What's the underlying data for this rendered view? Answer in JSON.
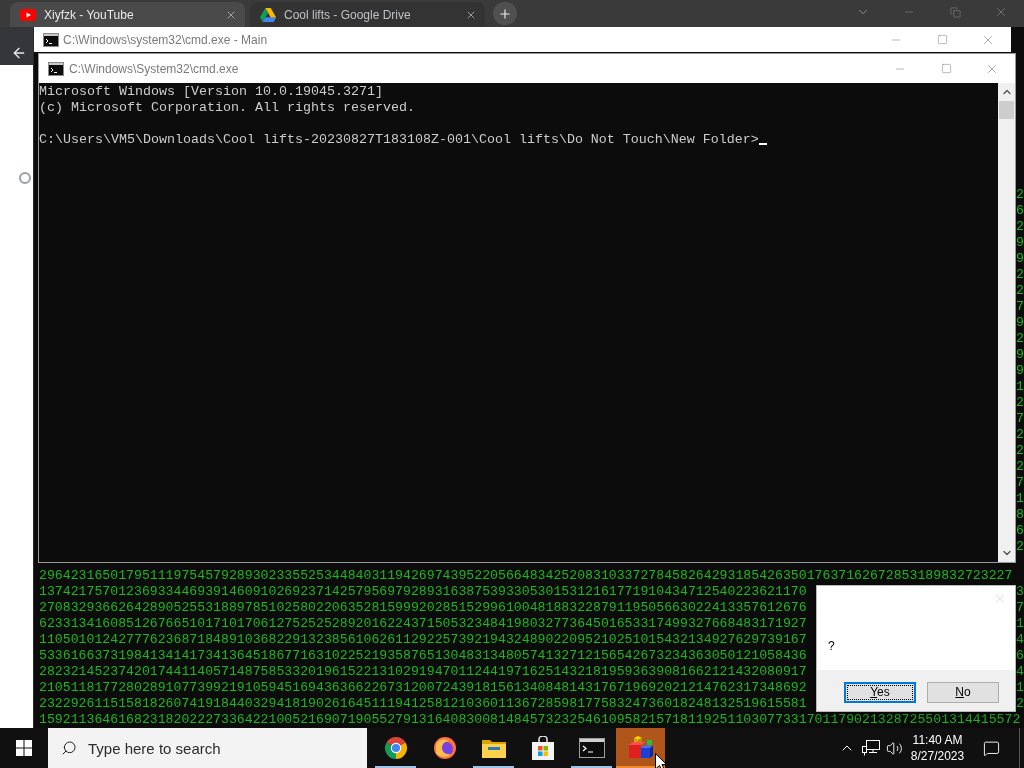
{
  "browser": {
    "tabs": [
      {
        "title": "Xiyfzk - YouTube",
        "kind": "video",
        "selected": true
      },
      {
        "title": "Cool lifts - Google Drive",
        "kind": "drive",
        "selected": false
      }
    ]
  },
  "main_console": {
    "title": "C:\\Windows\\system32\\cmd.exe - Main",
    "edge_column": "26299227929912722271862",
    "rows": [
      {
        "text": "296423165017951119754579289302335525344840311942697439522056648342520831033727845826429318542635017637162672853189832723227"
      },
      {
        "text": "1374217570123693344693914609102692371425795697928931638753933053015312161771910434712540223621170",
        "edge": "3"
      },
      {
        "text": "2708329366264289052553188978510258022063528159992028515299610048188322879119505663022413357612676",
        "edge": "7"
      },
      {
        "text": "6233134160851267665101710170612752525289201622437150532348419803277364501653317499327668483171927",
        "edge": "1"
      },
      {
        "text": "1105010124277762368718489103682291323856106261129225739219432489022095210251015432134927629739167",
        "edge": "4"
      },
      {
        "text": "5336166373198413414173413645186771631022521935876513048313480574132712156542673234363050121058436",
        "edge": "6"
      },
      {
        "text": "2823214523742017441140571487585332019615221310291947011244197162514321819593639081662121432080917",
        "edge": "4"
      },
      {
        "text": "2105118177280289107739921910594516943636622673120072439181561340848143176719692021214762317348692",
        "edge": "1"
      },
      {
        "text": "2322926115158182607419184403294181902616451119412581210360113672859817758324736018248132519615581",
        "edge": "2"
      },
      {
        "text": "1592113646168231820222733642210052169071905527913164083008148457323254610958215718119251103077331701179021328725501314415572"
      }
    ]
  },
  "front_console": {
    "title": "C:\\Windows\\System32\\cmd.exe",
    "banner": [
      "Microsoft Windows [Version 10.0.19045.3271]",
      "(c) Microsoft Corporation. All rights reserved."
    ],
    "prompt": "C:\\Users\\VM5\\Downloads\\Cool lifts-20230827T183108Z-001\\Cool lifts\\Do Not Touch\\New Folder>"
  },
  "dialog": {
    "message": "?",
    "buttons": [
      {
        "label": "Yes",
        "focused": true
      },
      {
        "label": "No",
        "focused": false
      }
    ]
  },
  "taskbar": {
    "search": {
      "placeholder": "Type here to search"
    },
    "apps": [
      {
        "kind": "chrome",
        "running": true,
        "flashing": false
      },
      {
        "kind": "firefox",
        "running": false,
        "flashing": false
      },
      {
        "kind": "explorer",
        "running": true,
        "flashing": false
      },
      {
        "kind": "store",
        "running": false,
        "flashing": false
      },
      {
        "kind": "terminal",
        "running": true,
        "flashing": false
      },
      {
        "kind": "cubes",
        "running": true,
        "flashing": true
      }
    ],
    "clock": {
      "time": "11:40 AM",
      "date": "8/27/2023"
    }
  }
}
